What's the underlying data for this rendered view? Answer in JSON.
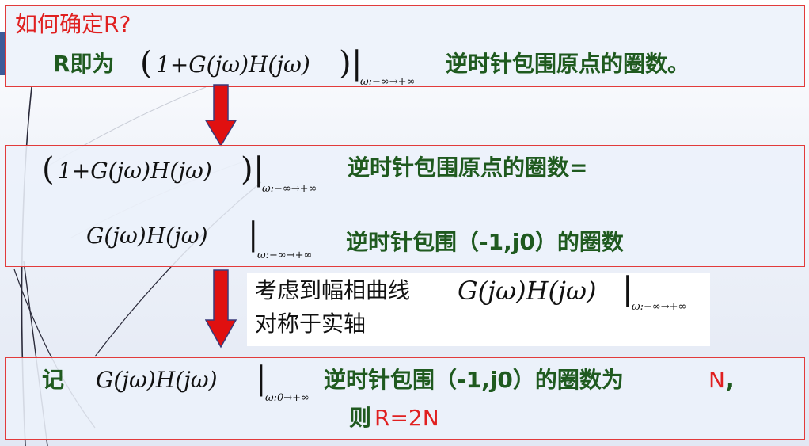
{
  "colors": {
    "border": "#e23b3b",
    "red_text": "#e02020",
    "green_text": "#1f5a1f",
    "arrow_fill": "#e01010",
    "arrow_stroke": "#3a3a7a"
  },
  "box1": {
    "question": "如何确定R?",
    "r_prefix": "R即为",
    "expr_open": "(",
    "expr": "1+G(jω)H(jω)",
    "expr_close": ")",
    "bar": "|",
    "subscript": "ω:−∞→+∞",
    "tail": "逆时针包围原点的圈数。"
  },
  "box2": {
    "line1_open": "(",
    "line1_expr": "1+G(jω)H(jω)",
    "line1_close": ")",
    "line1_bar": "|",
    "line1_sub": "ω:−∞→+∞",
    "line1_text": "逆时针包围原点的圈数=",
    "line2_expr": "G(jω)H(jω)",
    "line2_bar": "|",
    "line2_sub": "ω:−∞→+∞",
    "line2_text": "逆时针包围（-1,j0）的圈数"
  },
  "box3": {
    "line1_text": "考虑到幅相曲线",
    "line1_expr": "G(jω)H(jω)",
    "line1_bar": "|",
    "line1_sub": "ω:−∞→+∞",
    "line2_text": "对称于实轴"
  },
  "box4": {
    "ji": "记",
    "expr": "G(jω)H(jω)",
    "bar": "|",
    "sub": "ω:0→+∞",
    "text": "逆时针包围（-1,j0）的圈数为",
    "n": "N",
    "comma": ",",
    "ze": "则",
    "result": "R=2N"
  }
}
